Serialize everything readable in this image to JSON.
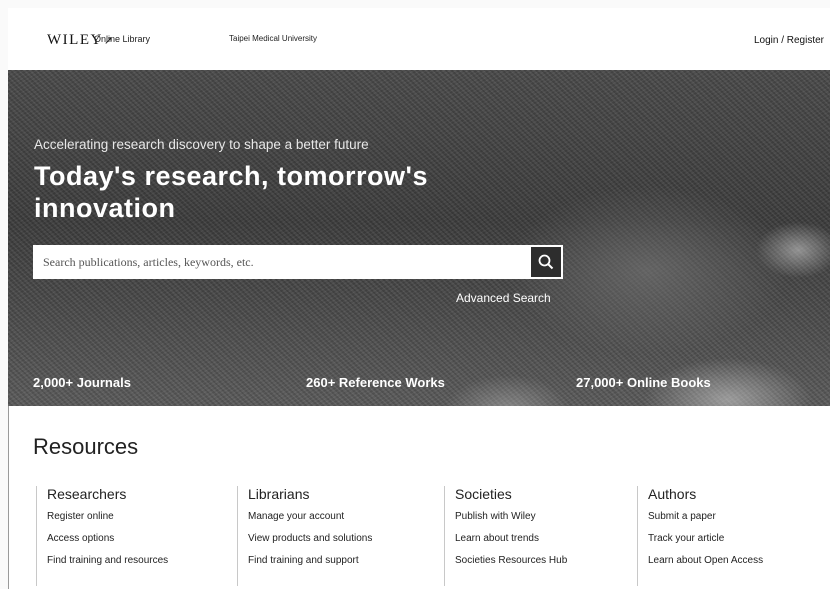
{
  "header": {
    "brand_name": "WILEY",
    "brand_sub": "Online Library",
    "institution": "Taipei Medical University",
    "login_label": "Login / Register"
  },
  "hero": {
    "tagline": "Accelerating research discovery to shape a better future",
    "headline": "Today's research, tomorrow's innovation",
    "search_placeholder": "Search publications, articles, keywords, etc.",
    "search_icon": "search-icon",
    "advanced_search_label": "Advanced Search",
    "stats": [
      "2,000+ Journals",
      "260+ Reference Works",
      "27,000+ Online Books"
    ]
  },
  "resources": {
    "title": "Resources",
    "columns": [
      {
        "heading": "Researchers",
        "links": [
          "Register online",
          "Access options",
          "Find training and resources"
        ]
      },
      {
        "heading": "Librarians",
        "links": [
          "Manage your account",
          "View products and solutions",
          "Find training and support"
        ]
      },
      {
        "heading": "Societies",
        "links": [
          "Publish with Wiley",
          "Learn about trends",
          "Societies Resources Hub"
        ]
      },
      {
        "heading": "Authors",
        "links": [
          "Submit a paper",
          "Track your article",
          "Learn about Open Access"
        ]
      }
    ]
  }
}
